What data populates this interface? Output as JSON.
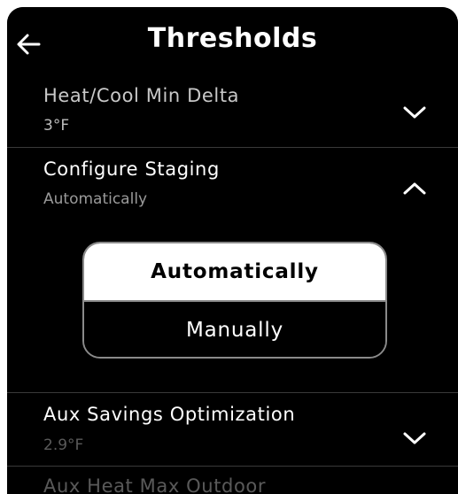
{
  "header": {
    "title": "Thresholds",
    "back_icon": "back-arrow-icon"
  },
  "settings": [
    {
      "label": "Heat/Cool Min Delta",
      "value": "3°F",
      "expanded": false
    },
    {
      "label": "Configure Staging",
      "value": "Automatically",
      "expanded": true,
      "options": [
        "Automatically",
        "Manually"
      ],
      "selected": "Automatically"
    },
    {
      "label": "Aux Savings Optimization",
      "value": "2.9°F",
      "expanded": false
    },
    {
      "label": "Aux Heat Max Outdoor"
    }
  ],
  "colors": {
    "background": "#000000",
    "text": "#ffffff",
    "selected_bg": "#ffffff",
    "selected_text": "#000000",
    "muted": "#9a9a9a"
  }
}
